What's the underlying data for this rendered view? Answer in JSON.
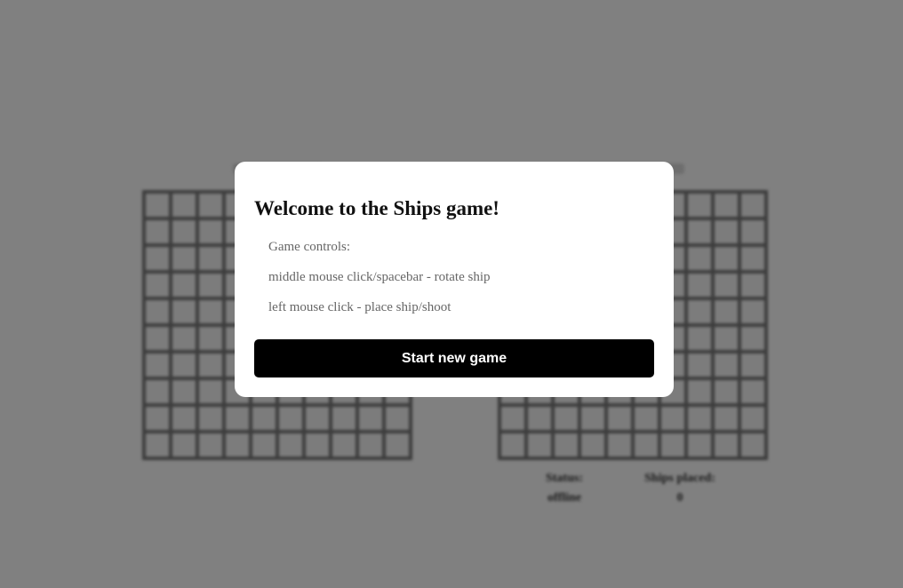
{
  "modal": {
    "title": "Welcome to the Ships game!",
    "controls_heading": "Game controls:",
    "controls": [
      "middle mouse click/spacebar - rotate ship",
      "left mouse click - place ship/shoot"
    ],
    "start_button": "Start new game"
  },
  "status": {
    "status_label": "Status:",
    "status_value": "offline",
    "ships_label": "Ships placed:",
    "ships_value": "0"
  },
  "colors": {
    "overlay": "#808080",
    "modal_bg": "#ffffff",
    "button_bg": "#000000",
    "button_text": "#ffffff"
  }
}
